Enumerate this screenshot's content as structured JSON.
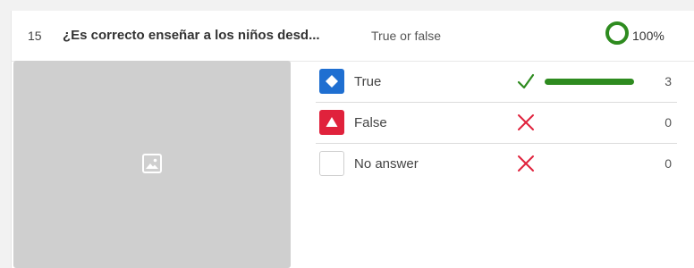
{
  "question": {
    "number": "15",
    "title": "¿Es correcto enseñar a los niños desd...",
    "type": "True or false",
    "percent_label": "100%",
    "ring_color": "#2e8b1f"
  },
  "image_placeholder": {
    "icon": "image-icon"
  },
  "answers": [
    {
      "label": "True",
      "badge_icon": "diamond-icon",
      "badge_color": "#1f6fd1",
      "mark": "check-icon",
      "mark_color": "#2e8b1f",
      "bar_fraction": 1.0,
      "count": "3"
    },
    {
      "label": "False",
      "badge_icon": "triangle-icon",
      "badge_color": "#e0223c",
      "mark": "cross-icon",
      "mark_color": "#e0223c",
      "bar_fraction": 0,
      "count": "0"
    },
    {
      "label": "No answer",
      "badge_icon": "none",
      "badge_color": "#ffffff",
      "mark": "cross-icon",
      "mark_color": "#e0223c",
      "bar_fraction": 0,
      "count": "0"
    }
  ]
}
